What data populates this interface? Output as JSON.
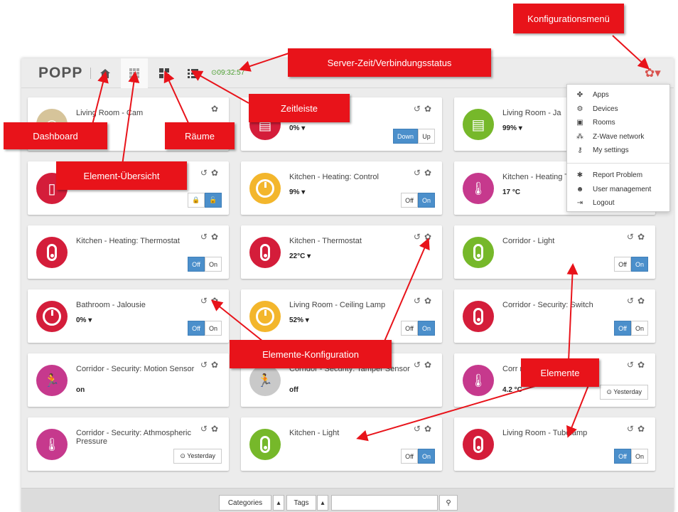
{
  "navbar": {
    "logo": "POPP",
    "home_icon": "home-icon",
    "elements_icon": "grid-icon",
    "rooms_icon": "rooms-icon",
    "timeline_icon": "list-icon",
    "clock": "⊙09:32:57",
    "config_icon": "gear-icon"
  },
  "menu": {
    "items": [
      {
        "label": "Apps",
        "icon": "apps-icon"
      },
      {
        "label": "Devices",
        "icon": "devices-icon"
      },
      {
        "label": "Rooms",
        "icon": "rooms-icon"
      },
      {
        "label": "Z-Wave network",
        "icon": "network-icon"
      },
      {
        "label": "My settings",
        "icon": "key-icon"
      },
      {
        "label": "Report Problem",
        "icon": "bug-icon"
      },
      {
        "label": "User management",
        "icon": "users-icon"
      },
      {
        "label": "Logout",
        "icon": "logout-icon"
      }
    ]
  },
  "cards": [
    {
      "title": "Living Room - Cam",
      "value": "",
      "color": "#d6c49a",
      "icon": "cam-icon",
      "buttons": [],
      "history": false
    },
    {
      "title": "e",
      "value": "0% ▾",
      "color": "#d41d3a",
      "icon": "blinds-icon",
      "buttons": [
        "Down",
        "Up"
      ],
      "active": 0,
      "history": true
    },
    {
      "title": "Living Room - Ja",
      "value": "99% ▾",
      "color": "#76b82a",
      "icon": "blinds-icon",
      "buttons": [],
      "history": false
    },
    {
      "title": "",
      "value": "",
      "color": "#d41d3a",
      "icon": "door-icon",
      "buttons": [
        "🔒",
        "🔓"
      ],
      "active": 1,
      "history": true
    },
    {
      "title": "Kitchen - Heating: Control",
      "value": "9% ▾",
      "color": "#f3b62c",
      "icon": "dial-icon",
      "buttons": [
        "Off",
        "On"
      ],
      "active": 1,
      "history": true
    },
    {
      "title": "Kitchen - Heating Temperature",
      "value": "17 °C",
      "color": "#c6398d",
      "icon": "thermometer-icon",
      "buttons": [],
      "history": true
    },
    {
      "title": "Kitchen - Heating: Thermostat",
      "value": "",
      "color": "#d41d3a",
      "icon": "switch-icon",
      "buttons": [
        "Off",
        "On"
      ],
      "active": 0,
      "history": true
    },
    {
      "title": "Kitchen - Thermostat",
      "value": "22°C ▾",
      "color": "#d41d3a",
      "icon": "switch-icon",
      "buttons": [],
      "history": true
    },
    {
      "title": "Corridor - Light",
      "value": "",
      "color": "#76b82a",
      "icon": "switch-icon",
      "buttons": [
        "Off",
        "On"
      ],
      "active": 1,
      "history": true
    },
    {
      "title": "Bathroom - Jalousie",
      "value": "0% ▾",
      "color": "#d41d3a",
      "icon": "dial-icon",
      "buttons": [
        "Off",
        "On"
      ],
      "active": 0,
      "history": true
    },
    {
      "title": "Living Room - Ceiling Lamp",
      "value": "52% ▾",
      "color": "#f3b62c",
      "icon": "dial-icon",
      "buttons": [
        "Off",
        "On"
      ],
      "active": 1,
      "history": true
    },
    {
      "title": "Corridor - Security: Switch",
      "value": "",
      "color": "#d41d3a",
      "icon": "switch-icon",
      "buttons": [
        "Off",
        "On"
      ],
      "active": 0,
      "history": true
    },
    {
      "title": "Corridor - Security: Motion Sensor",
      "value": "on",
      "color": "#c6398d",
      "icon": "motion-icon",
      "buttons": [],
      "history": true
    },
    {
      "title": "Corridor - Security: Tamper Sensor",
      "value": "off",
      "color": "#c9c9c9",
      "icon": "motion-icon",
      "buttons": [],
      "history": true
    },
    {
      "title": "Corr                     rature",
      "value": "4.2 °C",
      "color": "#c6398d",
      "icon": "thermometer-icon",
      "buttons": [
        "⊙ Yesterday"
      ],
      "active": -1,
      "history": true
    },
    {
      "title": "Corridor - Security: Athmospheric Pressure",
      "value": "",
      "color": "#c6398d",
      "icon": "thermometer-icon",
      "buttons": [
        "⊙ Yesterday"
      ],
      "active": -1,
      "history": true
    },
    {
      "title": "Kitchen - Light",
      "value": "",
      "color": "#76b82a",
      "icon": "switch-icon",
      "buttons": [
        "Off",
        "On"
      ],
      "active": 1,
      "history": true
    },
    {
      "title": "Living Room - Tubelamp",
      "value": "",
      "color": "#d41d3a",
      "icon": "switch-icon",
      "buttons": [
        "Off",
        "On"
      ],
      "active": 0,
      "history": true
    }
  ],
  "partial_yesterday": "Yesterday",
  "bottombar": {
    "categories": "Categories",
    "tags": "Tags",
    "search_value": "",
    "search_icon": "search-icon"
  },
  "callouts": {
    "config_menu": "Konfigurationsmenü",
    "server_time": "Server-Zeit/Verbindungsstatus",
    "timeline": "Zeitleiste",
    "dashboard": "Dashboard",
    "rooms": "Räume",
    "elements_overview": "Element-Übersicht",
    "elements_config": "Elemente-Konfiguration",
    "elements": "Elemente"
  }
}
